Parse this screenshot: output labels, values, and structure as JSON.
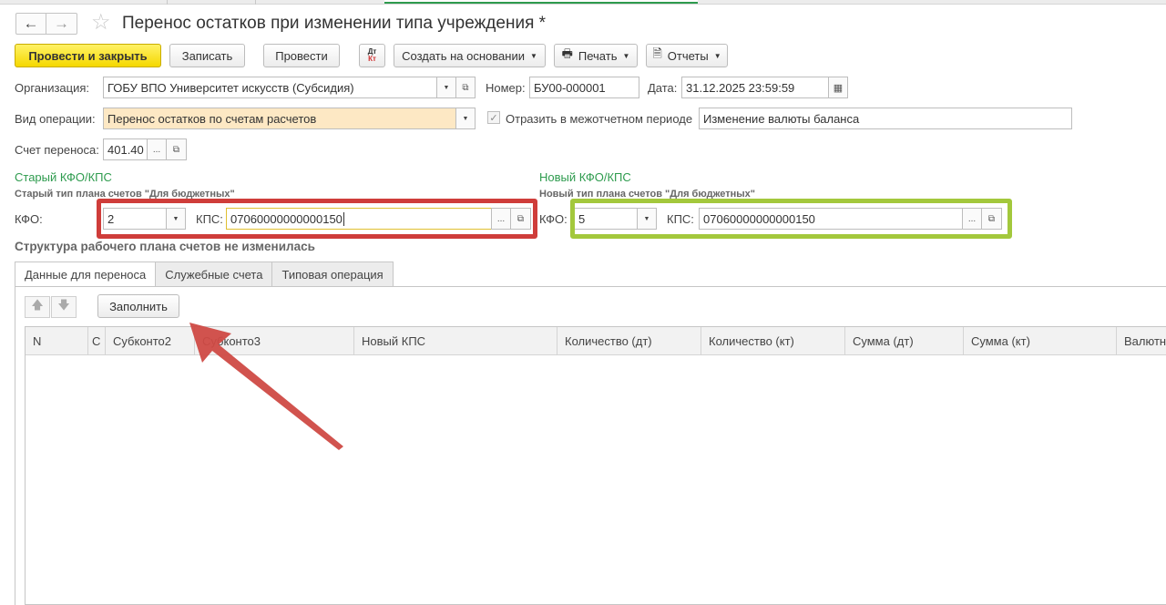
{
  "window": {
    "title": "Перенос остатков при изменении типа учреждения *"
  },
  "toolbar": {
    "post_close": "Провести и закрыть",
    "save": "Записать",
    "post": "Провести",
    "dtkt_top": "Дт",
    "dtkt_bottom": "Кт",
    "create_based": "Создать на основании",
    "print": "Печать",
    "reports": "Отчеты"
  },
  "header": {
    "org_label": "Организация:",
    "org_value": "ГОБУ ВПО Университет искусств (Субсидия)",
    "number_label": "Номер:",
    "number_value": "БУ00-000001",
    "date_label": "Дата:",
    "date_value": "31.12.2025 23:59:59",
    "optype_label": "Вид операции:",
    "optype_value": "Перенос остатков по счетам расчетов",
    "reflect_label": "Отразить в межотчетном периоде",
    "reflect_checked": true,
    "reflect_value": "Изменение валюты баланса",
    "account_label": "Счет переноса:",
    "account_value": "401.40"
  },
  "old": {
    "section": "Старый КФО/КПС",
    "plan": "Старый тип плана счетов \"Для бюджетных\"",
    "kfo_label": "КФО:",
    "kfo_value": "2",
    "kps_label": "КПС:",
    "kps_value": "07060000000000150"
  },
  "new": {
    "section": "Новый КФО/КПС",
    "plan": "Новый тип плана счетов \"Для бюджетных\"",
    "kfo_label": "КФО:",
    "kfo_value": "5",
    "kps_label": "КПС:",
    "kps_value": "07060000000000150"
  },
  "structure_note": "Структура рабочего плана счетов не изменилась",
  "tabs": [
    {
      "label": "Данные для переноса"
    },
    {
      "label": "Служебные счета"
    },
    {
      "label": "Типовая операция"
    }
  ],
  "fill_button": "Заполнить",
  "table": {
    "columns": [
      "N",
      "С",
      "Субконто2",
      "Субконто3",
      "Новый КПС",
      "Количество (дт)",
      "Количество (кт)",
      "Сумма (дт)",
      "Сумма (кт)",
      "Валютная"
    ]
  },
  "colors": {
    "highlight_old": "#cf3d3a",
    "highlight_new": "#a3c83c",
    "arrow": "#cf4a44",
    "section_green": "#2e9b4e",
    "primary_button": "#f5d800"
  }
}
